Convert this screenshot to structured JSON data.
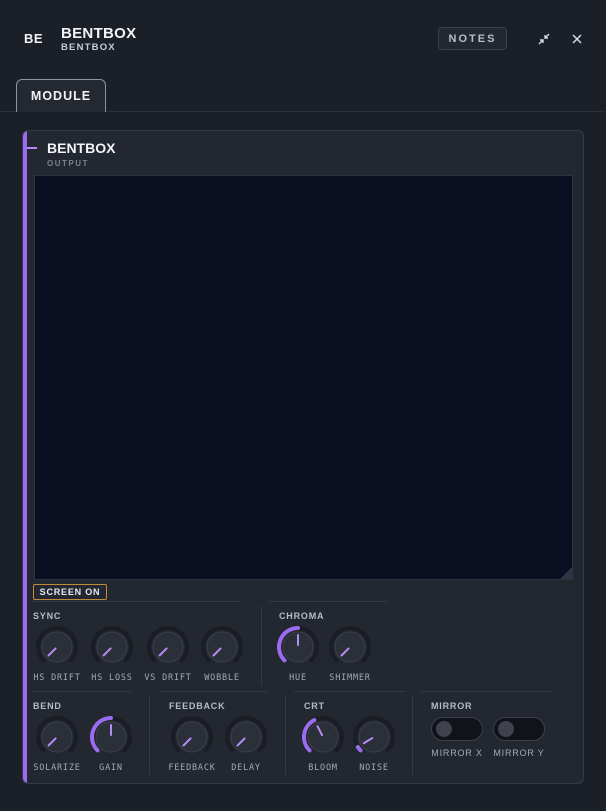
{
  "header": {
    "logo": "BE",
    "title": "BENTBOX",
    "subtitle": "BENTBOX",
    "notes_label": "NOTES",
    "minimize_icon": "collapse-arrows-icon",
    "close_icon": "close-icon"
  },
  "tabs": [
    {
      "label": "MODULE"
    }
  ],
  "panel": {
    "title": "BENTBOX",
    "subtitle": "OUTPUT",
    "screen_toggle": "SCREEN ON"
  },
  "colors": {
    "accent": "#9b6cf0",
    "screen_bg": "#0a0f22",
    "screen_on_border": "#c38a3a",
    "knob_body": "#2b2f38",
    "knob_track": "#1a1d24"
  },
  "groups": {
    "sync": {
      "label": "SYNC",
      "knobs": [
        {
          "label": "HS DRIFT",
          "value": 0.0
        },
        {
          "label": "HS LOSS",
          "value": 0.0
        },
        {
          "label": "VS DRIFT",
          "value": 0.0
        },
        {
          "label": "WOBBLE",
          "value": 0.0
        }
      ]
    },
    "chroma": {
      "label": "CHROMA",
      "knobs": [
        {
          "label": "HUE",
          "value": 0.5
        },
        {
          "label": "SHIMMER",
          "value": 0.0
        }
      ]
    },
    "bend": {
      "label": "BEND",
      "knobs": [
        {
          "label": "SOLARIZE",
          "value": 0.0
        },
        {
          "label": "GAIN",
          "value": 0.5
        }
      ]
    },
    "feedback": {
      "label": "FEEDBACK",
      "knobs": [
        {
          "label": "FEEDBACK",
          "value": 0.0
        },
        {
          "label": "DELAY",
          "value": 0.0
        }
      ]
    },
    "crt": {
      "label": "CRT",
      "knobs": [
        {
          "label": "BLOOM",
          "value": 0.4
        },
        {
          "label": "NOISE",
          "value": 0.05
        }
      ]
    },
    "mirror": {
      "label": "MIRROR",
      "toggles": [
        {
          "label": "MIRROR X",
          "on": false
        },
        {
          "label": "MIRROR Y",
          "on": false
        }
      ]
    }
  }
}
